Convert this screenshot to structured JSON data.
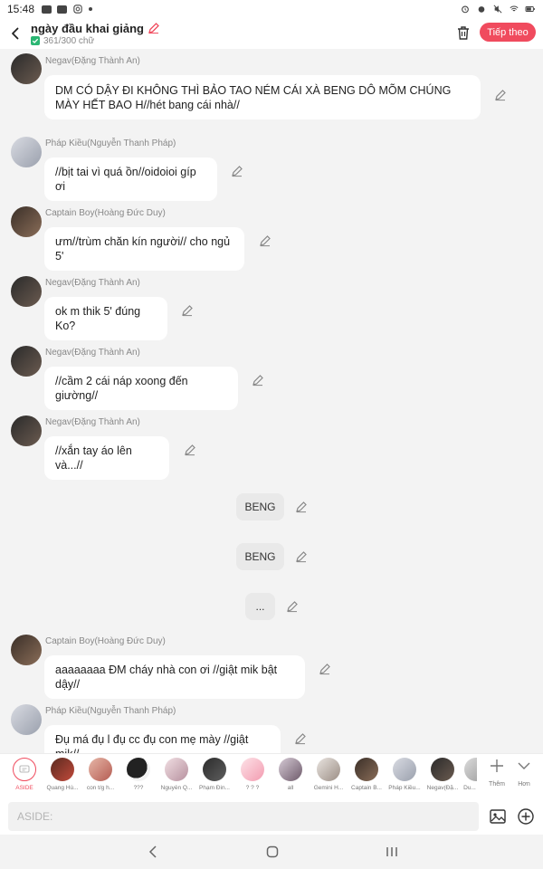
{
  "status_bar": {
    "time": "15:48"
  },
  "header": {
    "title": "ngày đầu khai giảng",
    "char_count": "361/300 chữ",
    "next_label": "Tiếp theo"
  },
  "messages": [
    {
      "name": "Negav(Đặng Thành An)",
      "text": "DM CÓ DẬY ĐI KHÔNG THÌ BẢO TAO NÉM CÁI XÀ BENG DÔ MÕM CHÚNG MÀY HẾT BAO H//hét bang cái nhà//"
    },
    {
      "name": "Pháp Kiều(Nguyễn Thanh Pháp)",
      "text": "//bịt tai vì quá ồn//oidoioi gíp ơi"
    },
    {
      "name": "Captain Boy(Hoàng Đức Duy)",
      "text": "ưm//trùm chăn kín người// cho ngủ 5'"
    },
    {
      "name": "Negav(Đặng Thành An)",
      "text": "ok m thik 5' đúng Ko?"
    },
    {
      "name": "Negav(Đặng Thành An)",
      "text": "//cầm 2 cái náp xoong đến giường//"
    },
    {
      "name": "Negav(Đặng Thành An)",
      "text": "//xắn tay áo lên và...//"
    },
    {
      "name": "Captain Boy(Hoàng Đức Duy)",
      "text": "aaaaaaaa ĐM cháy nhà con ơi //giật mik bật dậy//"
    },
    {
      "name": "Pháp Kiều(Nguyễn Thanh Pháp)",
      "text": "Đụ má đụ l đụ cc đụ con mẹ mày //giật mik//"
    }
  ],
  "asides": [
    "BENG",
    "BENG",
    "..."
  ],
  "characters": [
    {
      "label": "ASIDE"
    },
    {
      "label": "Quang Hù..."
    },
    {
      "label": "con t/g h..."
    },
    {
      "label": "???"
    },
    {
      "label": "Nguyễn Q..."
    },
    {
      "label": "Phạm Đin..."
    },
    {
      "label": "? ? ?"
    },
    {
      "label": "all"
    },
    {
      "label": "Gemini H..."
    },
    {
      "label": "Captain B..."
    },
    {
      "label": "Pháp Kiều..."
    },
    {
      "label": "Negav(Đặ..."
    },
    {
      "label": "Du..."
    }
  ],
  "strip_buttons": {
    "add_label": "Thêm",
    "more_label": "Hơn"
  },
  "input": {
    "placeholder": "ASIDE:"
  },
  "colors": {
    "accent": "#f04b5e",
    "check": "#2bb673",
    "background": "#f3f3f3"
  },
  "icons": [
    "back-arrow-icon",
    "edit-pencil-icon",
    "check-icon",
    "trash-icon",
    "image-icon",
    "add-circle-icon",
    "plus-icon",
    "chevron-down-icon",
    "nav-back-icon",
    "nav-home-icon",
    "nav-recents-icon"
  ]
}
